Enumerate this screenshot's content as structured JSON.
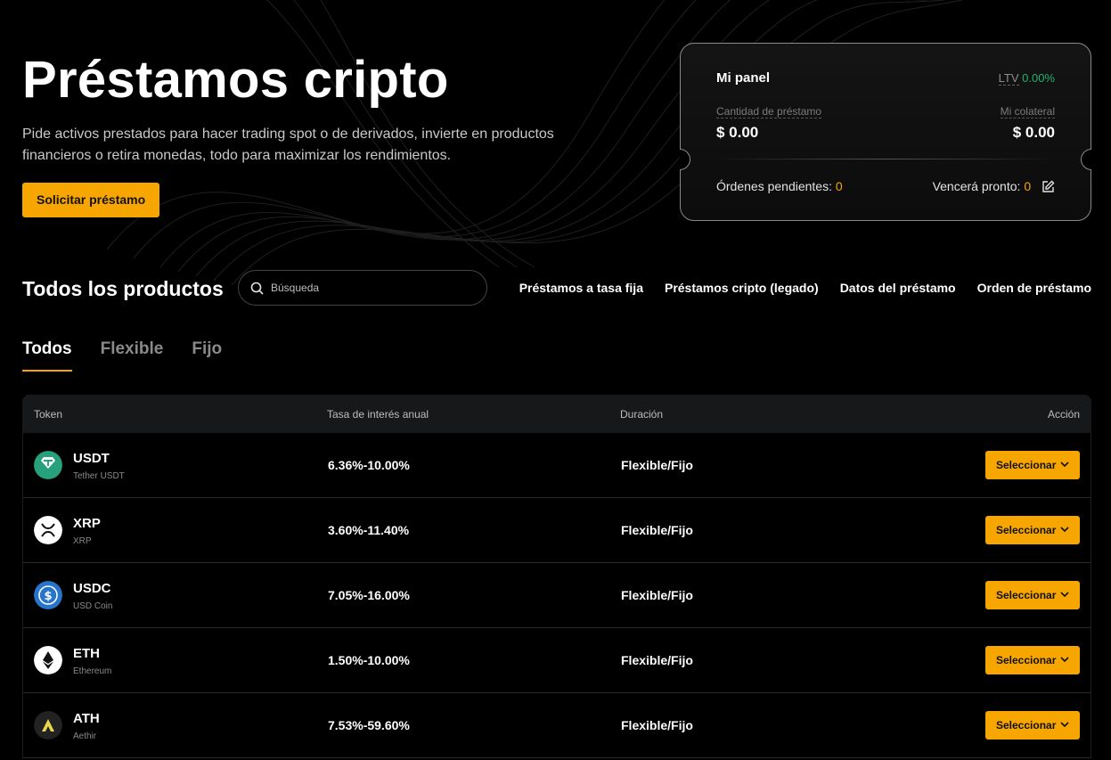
{
  "hero": {
    "title": "Préstamos cripto",
    "description": "Pide activos prestados para hacer trading spot o de derivados, invierte en productos financieros o retira monedas, todo para maximizar los rendimientos.",
    "cta_label": "Solicitar préstamo"
  },
  "panel": {
    "title": "Mi panel",
    "ltv_label": "LTV",
    "ltv_value": "0.00%",
    "loan_label": "Cantidad de préstamo",
    "loan_value": "$ 0.00",
    "collateral_label": "Mi colateral",
    "collateral_value": "$ 0.00",
    "pending_label": "Órdenes pendientes:",
    "pending_value": "0",
    "expiring_label": "Vencerá pronto:",
    "expiring_value": "0"
  },
  "products": {
    "title": "Todos los productos",
    "search_placeholder": "Búsqueda",
    "links": [
      "Préstamos a tasa fija",
      "Préstamos cripto (legado)",
      "Datos del préstamo",
      "Orden de préstamo"
    ],
    "tabs": [
      "Todos",
      "Flexible",
      "Fijo"
    ]
  },
  "table": {
    "headers": [
      "Token",
      "Tasa de interés anual",
      "Duración",
      "Acción"
    ],
    "rows": [
      {
        "symbol": "USDT",
        "name": "Tether USDT",
        "rate": "6.36%-10.00%",
        "duration": "Flexible/Fijo",
        "action": "Seleccionar",
        "icon": "usdt-icon"
      },
      {
        "symbol": "XRP",
        "name": "XRP",
        "rate": "3.60%-11.40%",
        "duration": "Flexible/Fijo",
        "action": "Seleccionar",
        "icon": "xrp-icon"
      },
      {
        "symbol": "USDC",
        "name": "USD Coin",
        "rate": "7.05%-16.00%",
        "duration": "Flexible/Fijo",
        "action": "Seleccionar",
        "icon": "usdc-icon"
      },
      {
        "symbol": "ETH",
        "name": "Ethereum",
        "rate": "1.50%-10.00%",
        "duration": "Flexible/Fijo",
        "action": "Seleccionar",
        "icon": "eth-icon"
      },
      {
        "symbol": "ATH",
        "name": "Aethir",
        "rate": "7.53%-59.60%",
        "duration": "Flexible/Fijo",
        "action": "Seleccionar",
        "icon": "ath-icon"
      }
    ]
  },
  "colors": {
    "accent": "#f7a600",
    "ltv": "#20b26c",
    "background": "#000000"
  }
}
